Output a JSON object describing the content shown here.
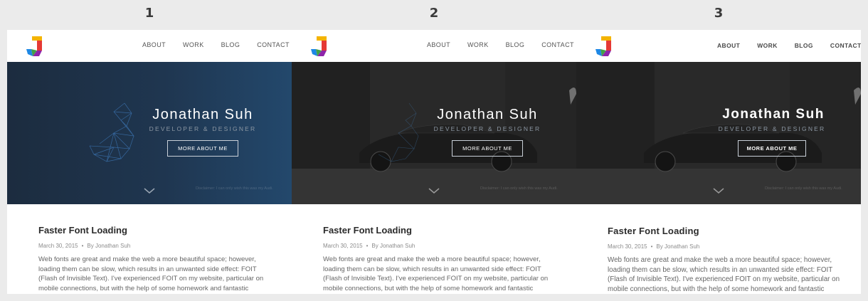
{
  "stages": [
    {
      "label": "1"
    },
    {
      "label": "2"
    },
    {
      "label": "3"
    }
  ],
  "site": {
    "logo": "J-logo-icon",
    "nav": [
      "ABOUT",
      "WORK",
      "BLOG",
      "CONTACT"
    ],
    "hero": {
      "name": "Jonathan Suh",
      "role": "DEVELOPER & DESIGNER",
      "button": "MORE ABOUT ME",
      "disclaimer": "Disclaimer: I can only wish this was my Audi."
    },
    "post": {
      "title": "Faster Font Loading",
      "date": "March 30, 2015",
      "separator": "•",
      "author": "By Jonathan Suh",
      "excerpt": "Web fonts are great and make the web a more beautiful space; however, loading them can be slow, which results in an unwanted side effect: FOIT (Flash of Invisible Text). I've experienced FOIT on my website, particular on mobile connections, but with the help of some homework and fantastic"
    }
  },
  "colors": {
    "hero_blue": "#1f3650",
    "hero_photo": "#2a2a2a",
    "page_background": "#ebebeb"
  }
}
